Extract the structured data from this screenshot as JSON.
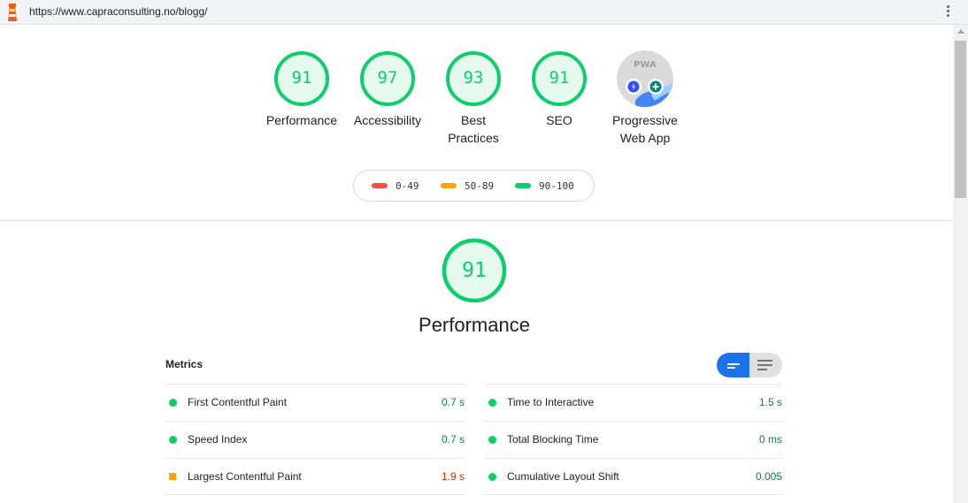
{
  "browser": {
    "url": "https://www.capraconsulting.no/blogg/"
  },
  "colors": {
    "pass": "#0cce6b",
    "average": "#ffa400",
    "fail": "#ff4e42",
    "toggle_active": "#1a73e8"
  },
  "summary_gauges": [
    {
      "score": "91",
      "label": "Performance"
    },
    {
      "score": "97",
      "label": "Accessibility"
    },
    {
      "score": "93",
      "label_line1": "Best",
      "label_line2": "Practices"
    },
    {
      "score": "91",
      "label": "SEO"
    }
  ],
  "pwa_gauge": {
    "badge_text": "PWA",
    "label_line1": "Progressive",
    "label_line2": "Web App"
  },
  "legend": [
    {
      "range": "0-49",
      "color": "#ff4e42"
    },
    {
      "range": "50-89",
      "color": "#ffa400"
    },
    {
      "range": "90-100",
      "color": "#0cce6b"
    }
  ],
  "performance": {
    "score": "91",
    "title": "Performance"
  },
  "metrics": {
    "heading": "Metrics",
    "left": [
      {
        "label": "First Contentful Paint",
        "value": "0.7 s",
        "status": "pass"
      },
      {
        "label": "Speed Index",
        "value": "0.7 s",
        "status": "pass"
      },
      {
        "label": "Largest Contentful Paint",
        "value": "1.9 s",
        "status": "average"
      }
    ],
    "right": [
      {
        "label": "Time to Interactive",
        "value": "1.5 s",
        "status": "pass"
      },
      {
        "label": "Total Blocking Time",
        "value": "0 ms",
        "status": "pass"
      },
      {
        "label": "Cumulative Layout Shift",
        "value": "0.005",
        "status": "pass"
      }
    ]
  }
}
